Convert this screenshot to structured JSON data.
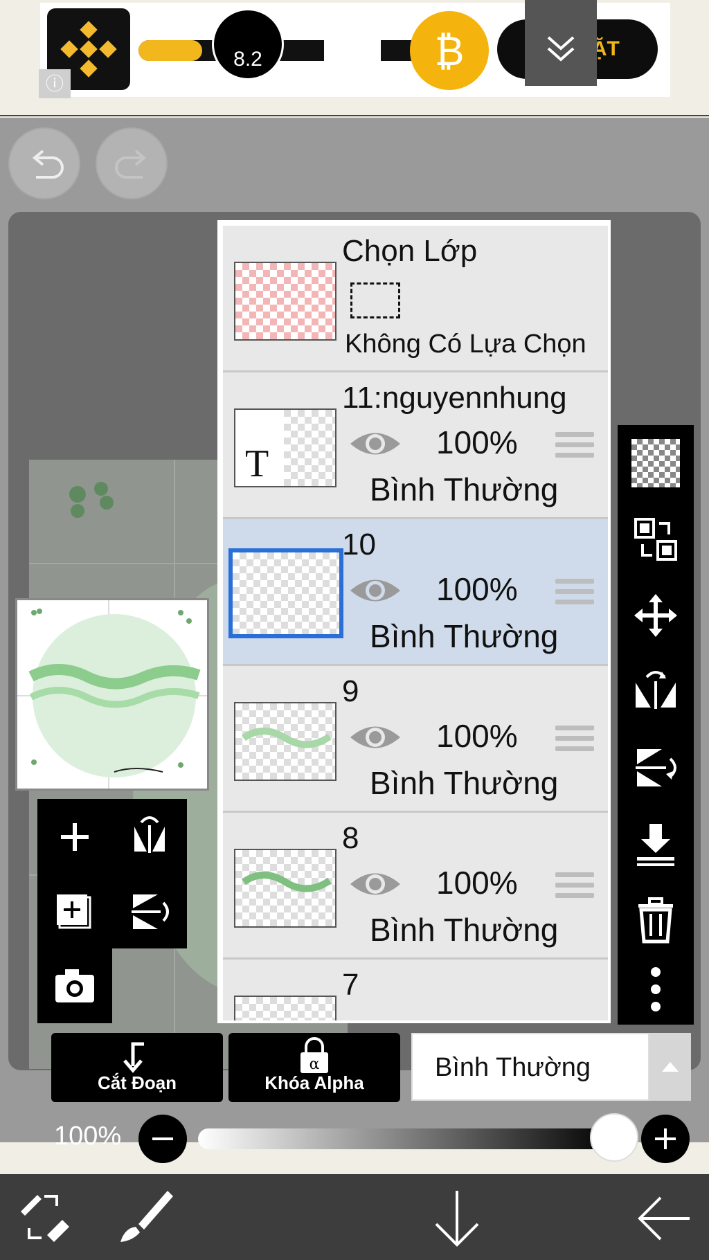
{
  "ad": {
    "install_label": "CÀI ĐẶT",
    "info_icon": "info-icon",
    "progress": 0.22,
    "colors": {
      "brand": "#f3b71e",
      "button_bg": "#0d0d0d"
    }
  },
  "toolbar_top": {
    "undo_icon": "undo-icon",
    "redo_icon": "redo-icon"
  },
  "selection_layer": {
    "title": "Chọn Lớp",
    "subtitle": "Không Có Lựa Chọn"
  },
  "layers": [
    {
      "name": "11:nguyennhung",
      "opacity": "100%",
      "blend": "Bình Thường",
      "thumb_text": "T",
      "selected": false
    },
    {
      "name": "10",
      "opacity": "100%",
      "blend": "Bình Thường",
      "selected": true
    },
    {
      "name": "9",
      "opacity": "100%",
      "blend": "Bình Thường",
      "selected": false
    },
    {
      "name": "8",
      "opacity": "100%",
      "blend": "Bình Thường",
      "selected": false
    },
    {
      "name": "7"
    }
  ],
  "actions": {
    "clip_label": "Cắt Đoạn",
    "alpha_lock_label": "Khóa Alpha",
    "blend_mode": "Bình Thường"
  },
  "opacity": {
    "value": "100%",
    "fraction": 1.0
  },
  "bottom_bar": {
    "brush_size": "8.2"
  },
  "colors": {
    "selected_row": "#cfdbeb",
    "selected_border": "#2a6fd6"
  }
}
